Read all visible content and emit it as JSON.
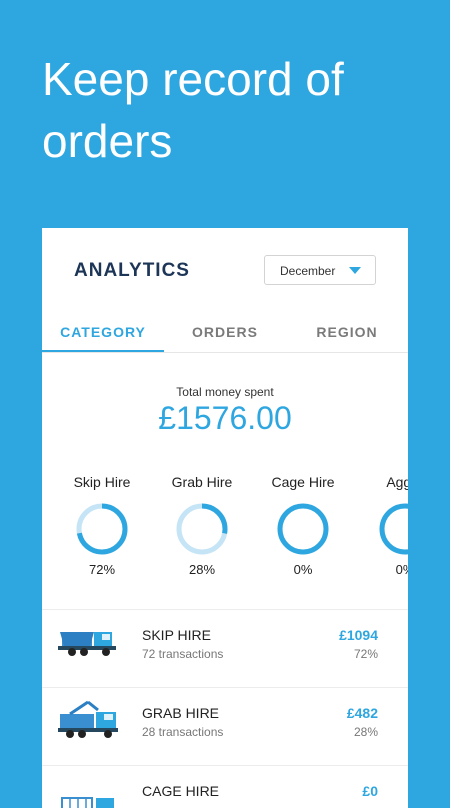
{
  "hero": {
    "line1": "Keep record of",
    "line2": "orders"
  },
  "card": {
    "title": "ANALYTICS",
    "month_select": {
      "value": "December"
    },
    "tabs": [
      {
        "label": "CATEGORY",
        "active": true
      },
      {
        "label": "ORDERS",
        "active": false
      },
      {
        "label": "REGION",
        "active": false
      }
    ],
    "total": {
      "label": "Total money spent",
      "value": "£1576.00"
    },
    "categories": [
      {
        "name": "Skip Hire",
        "percent_label": "72%",
        "fraction": 0.72
      },
      {
        "name": "Grab Hire",
        "percent_label": "28%",
        "fraction": 0.28
      },
      {
        "name": "Cage Hire",
        "percent_label": "0%",
        "fraction": 0
      },
      {
        "name": "Aggre",
        "percent_label": "0%",
        "fraction": 0
      }
    ],
    "rows": [
      {
        "name": "SKIP HIRE",
        "sub": "72 transactions",
        "amount": "£1094",
        "percent": "72%",
        "icon": "skip-truck-icon"
      },
      {
        "name": "GRAB HIRE",
        "sub": "28 transactions",
        "amount": "£482",
        "percent": "28%",
        "icon": "grab-truck-icon"
      },
      {
        "name": "CAGE HIRE",
        "sub": "",
        "amount": "£0",
        "percent": "",
        "icon": "cage-truck-icon"
      }
    ]
  },
  "colors": {
    "background": "#2ea6e0",
    "accent": "#2ea6e0",
    "ring_track": "#c5e4f6",
    "navy": "#1d3557"
  }
}
